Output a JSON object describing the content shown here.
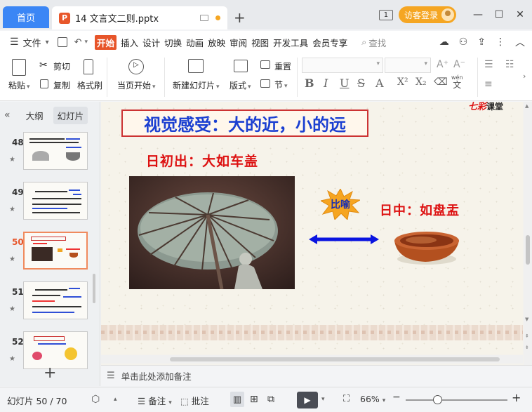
{
  "tabbar": {
    "home_label": "首页",
    "doc_badge": "P",
    "doc_title": "14 文言文二则.pptx",
    "new_tab_icon": "plus-icon",
    "num_badge": "1",
    "visitor_label": "访客登录",
    "accent_color": "#3b86f5"
  },
  "menubar": {
    "file_label": "文件",
    "items": [
      "开始",
      "插入",
      "设计",
      "切换",
      "动画",
      "放映",
      "审阅",
      "视图",
      "开发工具",
      "会员专享"
    ],
    "active_item": "开始",
    "search_label": "查找"
  },
  "ribbon": {
    "paste": "粘贴",
    "cut": "剪切",
    "copy": "复制",
    "format_painter": "格式刷",
    "start_from_current": "当页开始",
    "new_slide": "新建幻灯片",
    "layout": "版式",
    "reset": "重置",
    "section": "节",
    "pinyin_top": "wén",
    "pinyin_bottom": "文"
  },
  "left_pane": {
    "tab_outline": "大纲",
    "tab_slides": "幻灯片",
    "slides": [
      {
        "num": "48"
      },
      {
        "num": "49"
      },
      {
        "num": "50"
      },
      {
        "num": "51"
      },
      {
        "num": "52"
      }
    ],
    "active_slide": "50"
  },
  "slide": {
    "title": "视觉感受：大的近，小的远",
    "logo_main": "七彩",
    "logo_sub": "课堂",
    "subtitle_left": "日初出：大如车盖",
    "subtitle_right": "日中：如盘盂",
    "burst_label": "比喻",
    "title_color": "#1b3fd1",
    "subtitle_color": "#d11111"
  },
  "notes": {
    "placeholder": "单击此处添加备注"
  },
  "status": {
    "slide_counter": "幻灯片 50 / 70",
    "notes_label": "备注",
    "comments_label": "批注",
    "zoom_level": "66%"
  }
}
